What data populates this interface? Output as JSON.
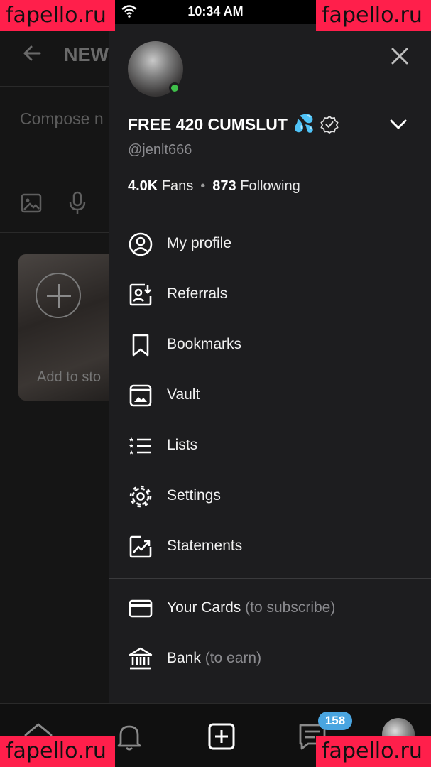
{
  "status_bar": {
    "time": "10:34 AM"
  },
  "watermark": "fapello.ru",
  "background_page": {
    "title": "NEW",
    "compose_placeholder": "Compose n",
    "story_label": "Add to sto"
  },
  "drawer": {
    "display_name": "FREE 420 CUMSLUT",
    "name_emoji": "💦",
    "handle": "@jenlt666",
    "fans_count": "4.0K",
    "fans_label": "Fans",
    "following_count": "873",
    "following_label": "Following",
    "menu": [
      {
        "label": "My profile",
        "icon": "user-circle-icon"
      },
      {
        "label": "Referrals",
        "icon": "referrals-icon"
      },
      {
        "label": "Bookmarks",
        "icon": "bookmark-icon"
      },
      {
        "label": "Vault",
        "icon": "vault-icon"
      },
      {
        "label": "Lists",
        "icon": "lists-icon"
      },
      {
        "label": "Settings",
        "icon": "gear-icon"
      },
      {
        "label": "Statements",
        "icon": "statements-icon"
      }
    ],
    "payments": [
      {
        "label": "Your Cards",
        "sub": "(to subscribe)",
        "icon": "card-icon"
      },
      {
        "label": "Bank",
        "sub": "(to earn)",
        "icon": "bank-icon"
      }
    ]
  },
  "bottom_nav": {
    "items": [
      "home-icon",
      "bell-icon",
      "add-icon",
      "messages-icon",
      "profile-avatar"
    ],
    "messages_badge": "158"
  },
  "colors": {
    "drawer_bg": "#1d1d1f",
    "online": "#3fbf4a",
    "badge": "#4aa5e0",
    "watermark": "#ff1f4b"
  }
}
